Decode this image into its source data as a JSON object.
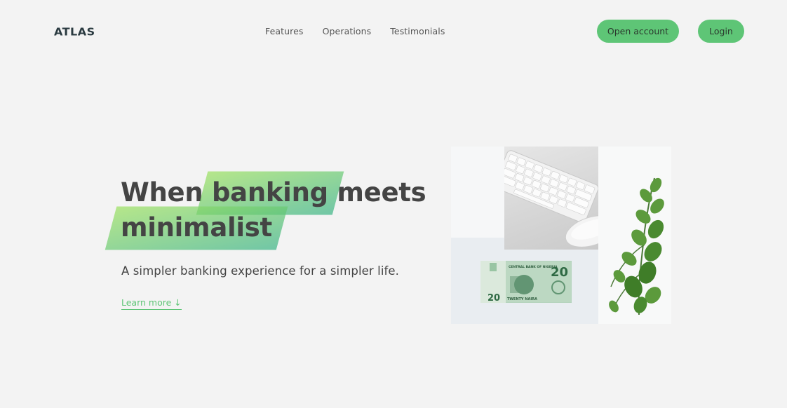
{
  "nav": {
    "logo": "ATLAS",
    "links": [
      "Features",
      "Operations",
      "Testimonials"
    ],
    "open_account": "Open account",
    "login": "Login"
  },
  "hero": {
    "title_when": "When",
    "title_banking": "banking",
    "title_meets": "meets",
    "title_minimalist": "minimalist",
    "subtitle": "A simpler banking experience for a simpler life.",
    "learn_more": "Learn more ↓"
  },
  "banknote": {
    "bank": "CENTRAL BANK OF NIGERIA",
    "value": "20",
    "words": "TWENTY NAIRA"
  },
  "colors": {
    "accent": "#5ec576",
    "background": "#f3f3f3",
    "text": "#444444"
  }
}
